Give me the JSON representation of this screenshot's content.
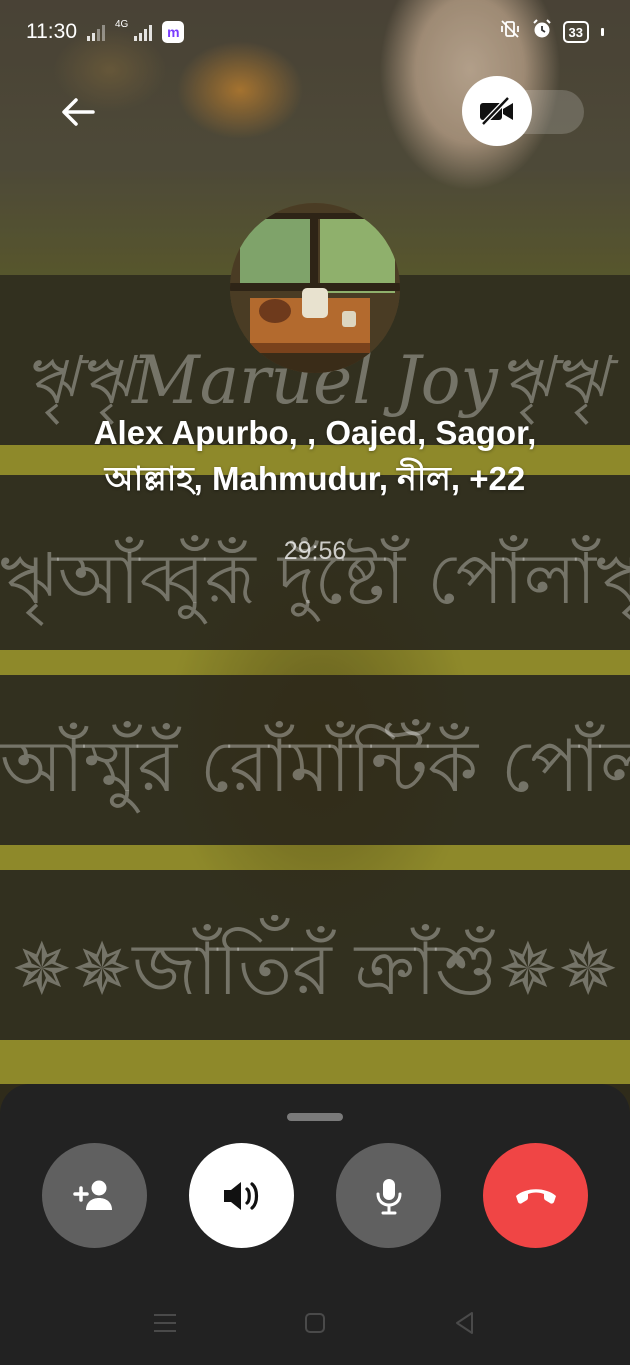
{
  "status_bar": {
    "time": "11:30",
    "network_badge": "4G",
    "app_badge": "m",
    "battery_level": "33",
    "icons": [
      "signal-icon",
      "signal-4g-icon",
      "messenger-icon",
      "vibrate-icon",
      "alarm-icon",
      "battery-icon"
    ]
  },
  "background": {
    "watermark_lines": [
      "ৠৠMaruel Joyৠৠ",
      "ৠআঁব্বুঁরূঁ দুঁষ্টোঁ পোঁলাঁৠ",
      "আঁম্মুঁরঁ রোঁমাঁন্টিঁকঁ পোঁলা",
      "✵✵জাঁতিঁরঁ ক্রাঁশুঁ✵✵"
    ]
  },
  "call": {
    "participants": "Alex Apurbo, , Oajed, Sagor, আল্লাহ, Mahmudur, নীল, +22",
    "duration": "29:56"
  },
  "controls": {
    "buttons": [
      "add-person",
      "speaker",
      "microphone",
      "end-call"
    ],
    "colors": {
      "end_call": "#f04545",
      "neutral": "#606060",
      "active": "#ffffff",
      "sheet": "#222222"
    }
  }
}
